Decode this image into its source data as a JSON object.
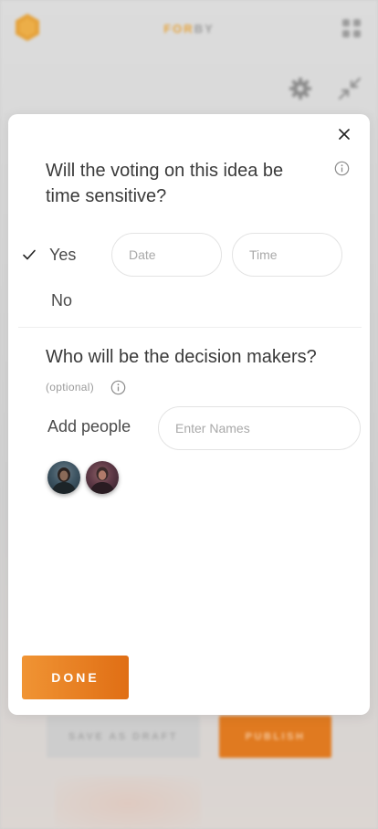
{
  "colors": {
    "accent": "#e5a23a",
    "done_start": "#f09434",
    "done_end": "#e06e14",
    "text": "#3a3a3a"
  },
  "background": {
    "brand_accent": "FOR",
    "brand_rest": "BY",
    "icons": [
      "hexagon-logo-icon",
      "grid-icon",
      "gear-icon",
      "collapse-icon"
    ],
    "save_draft_label": "SAVE AS DRAFT",
    "publish_label": "PUBLISH"
  },
  "modal": {
    "close_icon": "close-icon",
    "question_1": "Will the voting on this idea be time sensitive?",
    "options": {
      "yes": "Yes",
      "no": "No",
      "selected": "Yes"
    },
    "date_placeholder": "Date",
    "time_placeholder": "Time",
    "question_2": "Who will be the decision makers?",
    "optional_label": "(optional)",
    "add_people_label": "Add people",
    "names_placeholder": "Enter Names",
    "avatars": [
      "avatar-person-1",
      "avatar-person-2"
    ],
    "done_label": "DONE"
  }
}
